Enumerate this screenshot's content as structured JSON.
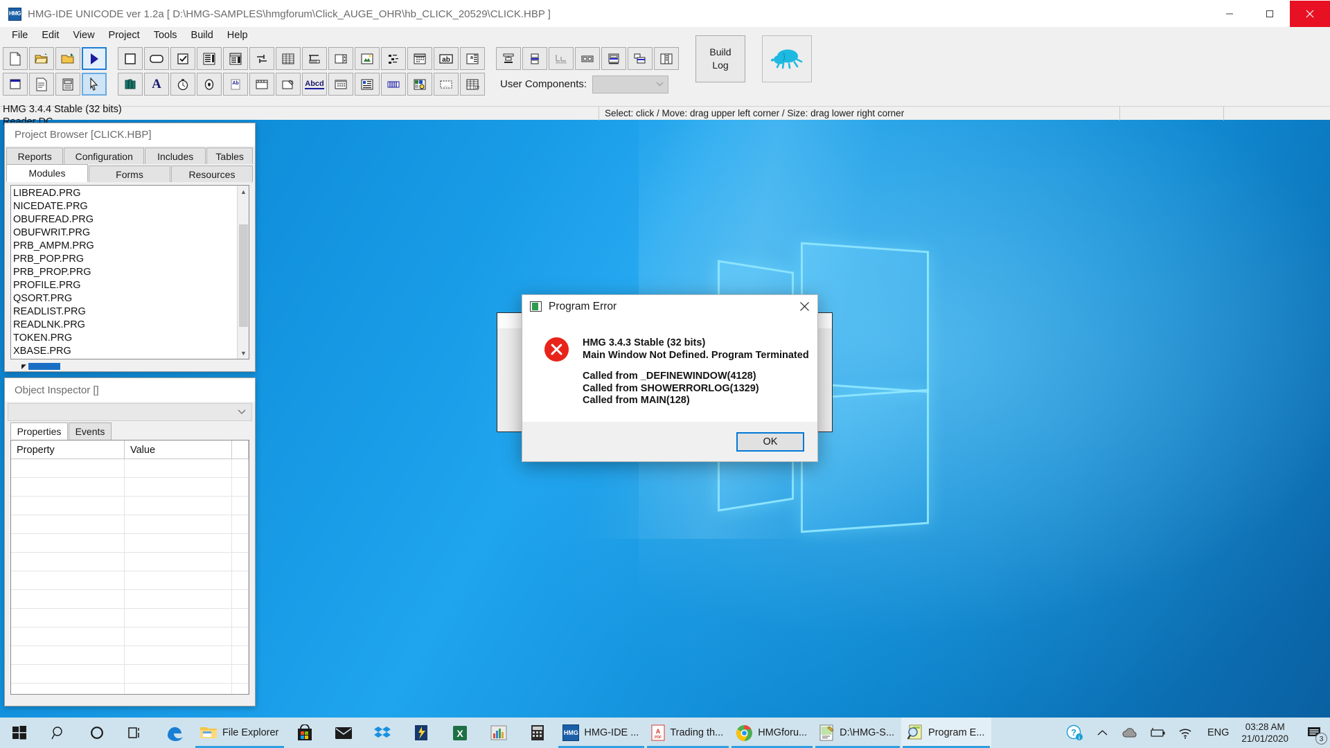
{
  "window": {
    "app_icon": "hmg-logo-icon",
    "title": "HMG-IDE  UNICODE  ver 1.2a  [ D:\\HMG-SAMPLES\\hmgforum\\Click_AUGE_OHR\\hb_CLICK_20529\\CLICK.HBP ]",
    "controls": {
      "minimize": "minimize-button",
      "maximize": "maximize-button",
      "close": "close-button"
    }
  },
  "menubar": {
    "items": [
      "File",
      "Edit",
      "View",
      "Project",
      "Tools",
      "Build",
      "Help"
    ]
  },
  "toolbar": {
    "row1": [
      {
        "name": "new-file-button",
        "glyph": "new"
      },
      {
        "name": "open-project-button",
        "glyph": "open"
      },
      {
        "name": "save-project-button",
        "glyph": "saveas"
      },
      {
        "name": "run-button",
        "glyph": "play",
        "selected": true
      },
      {
        "name": "insert-button-control",
        "glyph": "square"
      },
      {
        "name": "insert-textbox-control",
        "glyph": "rounded"
      },
      {
        "name": "insert-checkbox-control",
        "glyph": "check"
      },
      {
        "name": "insert-listbox-control",
        "glyph": "list"
      },
      {
        "name": "insert-combobox-control",
        "glyph": "combo"
      },
      {
        "name": "insert-slider-control",
        "glyph": "slider"
      },
      {
        "name": "insert-grid-control",
        "glyph": "grid"
      },
      {
        "name": "insert-progressbar-control",
        "glyph": "progress"
      },
      {
        "name": "insert-spinner-control",
        "glyph": "spin"
      },
      {
        "name": "insert-image-control",
        "glyph": "image"
      },
      {
        "name": "insert-treeview-control",
        "glyph": "tree"
      },
      {
        "name": "insert-monthcalendar-control",
        "glyph": "calendar"
      },
      {
        "name": "insert-label-control",
        "glyph": "ab"
      },
      {
        "name": "insert-browse-control",
        "glyph": "browse"
      }
    ],
    "row2": [
      {
        "name": "insert-window-control",
        "glyph": "window"
      },
      {
        "name": "insert-page-control",
        "glyph": "page"
      },
      {
        "name": "insert-richedit-control",
        "glyph": "richedit"
      },
      {
        "name": "select-pointer-button",
        "glyph": "pointer",
        "selected2": true
      },
      {
        "name": "insert-library-control",
        "glyph": "books"
      },
      {
        "name": "insert-font-control",
        "glyph": "font-a"
      },
      {
        "name": "insert-timer-control",
        "glyph": "clock"
      },
      {
        "name": "insert-radio-control",
        "glyph": "radio"
      },
      {
        "name": "insert-hotkey-control",
        "glyph": "hb"
      },
      {
        "name": "insert-frame-control",
        "glyph": "frame"
      },
      {
        "name": "insert-edit-control",
        "glyph": "edit"
      },
      {
        "name": "insert-text-control",
        "glyph": "abcd"
      },
      {
        "name": "insert-datepicker-control",
        "glyph": "datepick"
      },
      {
        "name": "insert-listview-control",
        "glyph": "listview"
      },
      {
        "name": "insert-statusbar-control",
        "glyph": "statusbar"
      },
      {
        "name": "insert-imagelist-control",
        "glyph": "imagelist"
      },
      {
        "name": "insert-dialog-control",
        "glyph": "dialog"
      },
      {
        "name": "insert-table-control",
        "glyph": "table"
      }
    ],
    "align_tools": [
      {
        "name": "align-top-button",
        "glyph": "aligntop"
      },
      {
        "name": "align-middle-button",
        "glyph": "alignmid"
      },
      {
        "name": "align-bottom-button",
        "glyph": "alignbot"
      },
      {
        "name": "align-horizontal-button",
        "glyph": "alignh"
      },
      {
        "name": "align-center-button",
        "glyph": "aligncenter"
      },
      {
        "name": "align-group-button",
        "glyph": "aligngroup"
      },
      {
        "name": "align-columns-button",
        "glyph": "aligncols"
      }
    ],
    "user_components_label": "User Components:",
    "user_components_value": "",
    "build_log_label_line1": "Build",
    "build_log_label_line2": "Log",
    "debug_icon": "bug-icon"
  },
  "ide_status": {
    "left": "",
    "hint": "Select: click / Move: drag upper left corner / Size: drag lower right corner",
    "cell3": "",
    "cell4": ""
  },
  "version_lines": {
    "line1": "HMG 3.4.4 Stable (32 bits)",
    "line2": "Reader DC"
  },
  "project_browser": {
    "caption": "Project Browser [CLICK.HBP]",
    "tabs_row1": [
      {
        "label": "Reports",
        "active": false
      },
      {
        "label": "Configuration",
        "active": false
      },
      {
        "label": "Includes",
        "active": false
      },
      {
        "label": "Tables",
        "active": false
      }
    ],
    "tabs_row2": [
      {
        "label": "Modules",
        "active": true
      },
      {
        "label": "Forms",
        "active": false
      },
      {
        "label": "Resources",
        "active": false
      }
    ],
    "modules": [
      "LIBREAD.PRG",
      "NICEDATE.PRG",
      "OBUFREAD.PRG",
      "OBUFWRIT.PRG",
      "PRB_AMPM.PRG",
      "PRB_POP.PRG",
      "PRB_PROP.PRG",
      "PROFILE.PRG",
      "QSORT.PRG",
      "READLIST.PRG",
      "READLNK.PRG",
      "TOKEN.PRG",
      "XBASE.PRG"
    ],
    "scroll_up_icon": "chevron-up-icon",
    "scroll_down_icon": "chevron-down-icon"
  },
  "object_inspector": {
    "caption": "Object Inspector []",
    "combo_value": "",
    "combo_icon": "chevron-down-icon",
    "tabs": [
      {
        "label": "Properties",
        "active": true
      },
      {
        "label": "Events",
        "active": false
      }
    ],
    "grid_headers": [
      "Property",
      "Value",
      ""
    ],
    "grid_rows": []
  },
  "dialog": {
    "icon": "program-window-icon",
    "title": "Program Error",
    "close_icon": "close-icon",
    "error_icon": "error-circle-icon",
    "message_line1": "HMG 3.4.3 Stable (32 bits)",
    "message_line2": "Main Window Not Defined. Program Terminated",
    "stack": [
      "Called from _DEFINEWINDOW(4128)",
      "Called from SHOWERRORLOG(1329)",
      "Called from MAIN(128)"
    ],
    "ok_label": "OK",
    "accent_color": "#0078d7",
    "error_color": "#e8241a"
  },
  "taskbar": {
    "start_icon": "windows-start-icon",
    "search_icon": "search-icon",
    "cortana_icon": "cortana-circle-icon",
    "taskview_icon": "task-view-icon",
    "pinned": [
      {
        "name": "edge-icon",
        "label": ""
      },
      {
        "name": "file-explorer-icon",
        "label": "File Explorer",
        "running": true
      },
      {
        "name": "microsoft-store-icon",
        "label": ""
      },
      {
        "name": "mail-icon",
        "label": ""
      },
      {
        "name": "dropbox-icon",
        "label": ""
      },
      {
        "name": "shell-icon",
        "label": ""
      },
      {
        "name": "excel-icon",
        "label": ""
      },
      {
        "name": "chart-app-icon",
        "label": ""
      },
      {
        "name": "calculator-icon",
        "label": ""
      }
    ],
    "apps": [
      {
        "name": "hmg-ide-task",
        "icon": "hmg-logo-icon",
        "label": "HMG-IDE  ...",
        "running": true,
        "active": false
      },
      {
        "name": "pdf-task",
        "icon": "pdf-icon",
        "label": "Trading th...",
        "running": true,
        "active": false
      },
      {
        "name": "chrome-task",
        "icon": "chrome-icon",
        "label": "HMGforu...",
        "running": true,
        "active": false
      },
      {
        "name": "editor-task",
        "icon": "notepad-icon",
        "label": "D:\\HMG-S...",
        "running": true,
        "active": false
      },
      {
        "name": "program-error-task",
        "icon": "magnifier-icon",
        "label": "Program E...",
        "running": true,
        "active": true
      }
    ],
    "tray": {
      "help_icon": "help-question-icon",
      "chevron_icon": "show-hidden-icons-icon",
      "onedrive_icon": "onedrive-cloud-icon",
      "battery_icon": "battery-icon",
      "network_icon": "wifi-icon",
      "language": "ENG",
      "time": "03:28 AM",
      "date": "21/01/2020",
      "notifications_icon": "action-center-icon",
      "notifications_count": "3"
    }
  }
}
